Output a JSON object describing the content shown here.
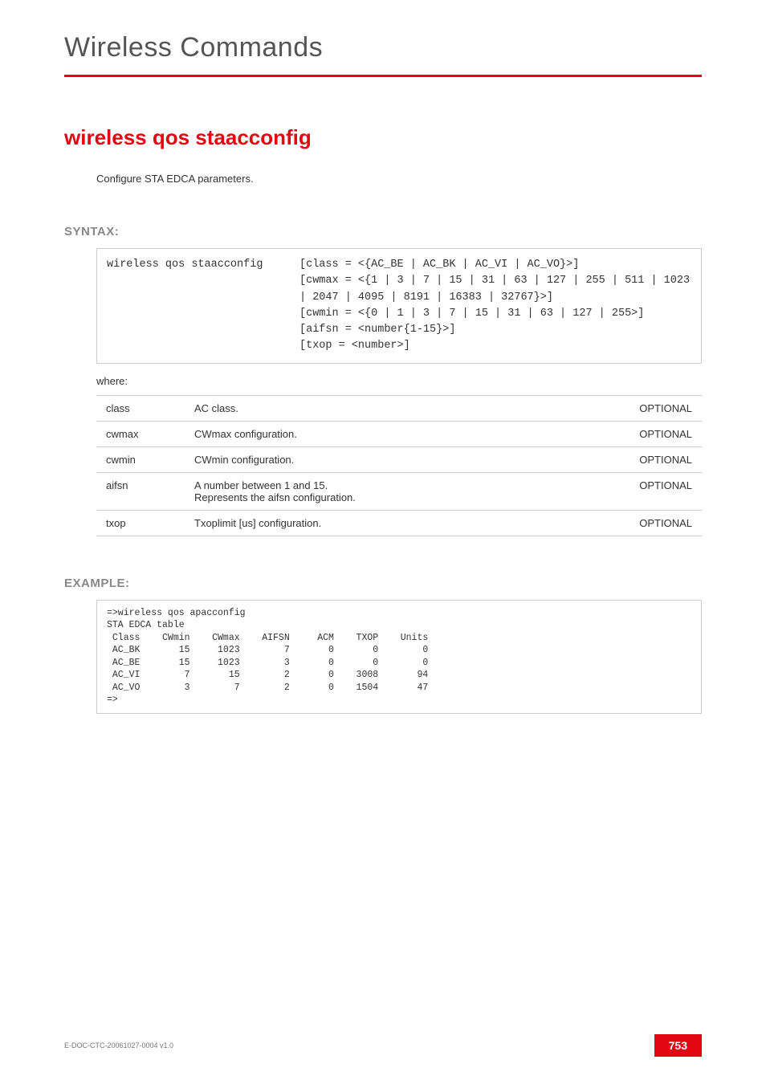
{
  "header": {
    "title": "Wireless Commands"
  },
  "command": {
    "title": "wireless qos staacconfig",
    "description": "Configure STA EDCA parameters."
  },
  "syntax": {
    "label": "SYNTAX:",
    "command": "wireless qos staacconfig",
    "args": "[class = <{AC_BE | AC_BK | AC_VI | AC_VO}>]\n[cwmax = <{1 | 3 | 7 | 15 | 31 | 63 | 127 | 255 | 511 | 1023 | 2047 | 4095 | 8191 | 16383 | 32767}>]\n[cwmin = <{0 | 1 | 3 | 7 | 15 | 31 | 63 | 127 | 255>]\n[aifsn = <number{1-15}>]\n[txop = <number>]"
  },
  "where_label": "where:",
  "params": [
    {
      "name": "class",
      "desc": "AC class.",
      "flag": "OPTIONAL"
    },
    {
      "name": "cwmax",
      "desc": "CWmax configuration.",
      "flag": "OPTIONAL"
    },
    {
      "name": "cwmin",
      "desc": "CWmin configuration.",
      "flag": "OPTIONAL"
    },
    {
      "name": "aifsn",
      "desc": "A number between 1 and 15.\nRepresents the aifsn configuration.",
      "flag": "OPTIONAL"
    },
    {
      "name": "txop",
      "desc": "Txoplimit [us] configuration.",
      "flag": "OPTIONAL"
    }
  ],
  "example": {
    "label": "EXAMPLE:",
    "text": "=>wireless qos apacconfig\nSTA EDCA table\n Class    CWmin    CWmax    AIFSN     ACM    TXOP    Units\n AC_BK       15     1023        7       0       0        0\n AC_BE       15     1023        3       0       0        0\n AC_VI        7       15        2       0    3008       94\n AC_VO        3        7        2       0    1504       47\n=>"
  },
  "footer": {
    "doc": "E-DOC-CTC-20061027-0004 v1.0",
    "page": "753"
  }
}
